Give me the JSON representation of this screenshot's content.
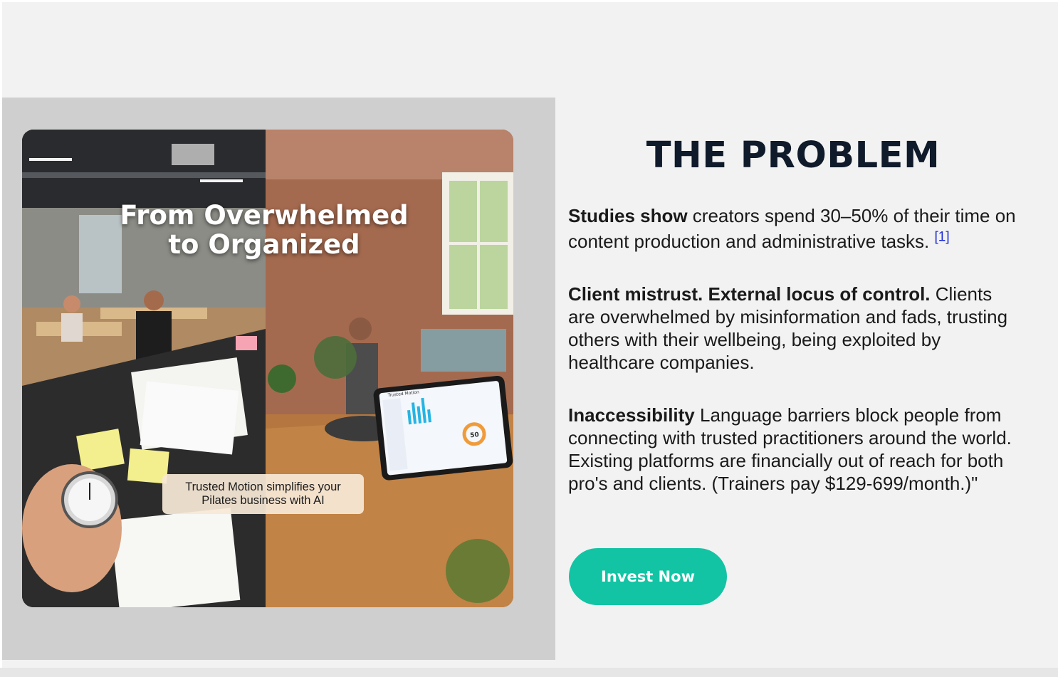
{
  "hero_image": {
    "title_line1": "From Overwhelmed",
    "title_line2": "to Organized",
    "caption_line1": "Trusted Motion simplifies your",
    "caption_line2": "Pilates business with AI",
    "app_name": "Trusted Motion",
    "gauge_value": "50"
  },
  "problem": {
    "title": "THE PROBLEM",
    "p1_bold": "Studies show",
    "p1_text": " creators spend 30–50% of their time on content production and administrative tasks. ",
    "p1_footnote": "[1]",
    "p2_bold": "Client mistrust. External locus of control.",
    "p2_text": " Clients are overwhelmed by misinformation and fads, trusting others with their wellbeing, being exploited by healthcare companies.",
    "p3_bold": "Inaccessibility",
    "p3_text": " Language barriers block people from connecting with trusted practitioners around the world. Existing platforms are financially out of reach for both pro's and clients. (Trainers pay $129-699/month.)\""
  },
  "cta": {
    "invest_label": "Invest Now"
  },
  "colors": {
    "accent": "#12c4a4",
    "title": "#0f1a2a",
    "footnote_link": "#1a2ad6",
    "panel_bg": "#cfcfcf",
    "page_bg": "#f2f2f2"
  }
}
